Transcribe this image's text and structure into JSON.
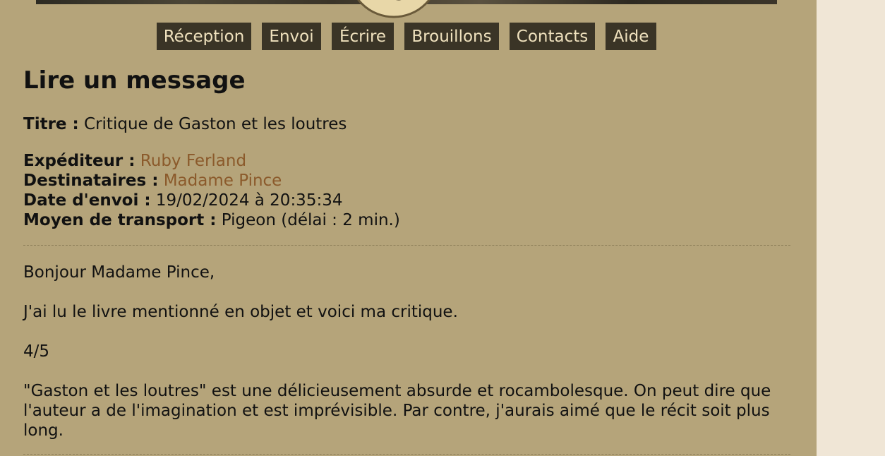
{
  "nav": {
    "items": [
      {
        "label": "Réception"
      },
      {
        "label": "Envoi"
      },
      {
        "label": "Écrire"
      },
      {
        "label": "Brouillons"
      },
      {
        "label": "Contacts"
      },
      {
        "label": "Aide"
      }
    ]
  },
  "page": {
    "title": "Lire un message"
  },
  "message": {
    "title_label": "Titre :",
    "title_value": "Critique de Gaston et les loutres",
    "sender_label": "Expéditeur :",
    "sender_value": "Ruby Ferland",
    "recipients_label": "Destinataires :",
    "recipients_value": "Madame Pince",
    "date_label": "Date d'envoi :",
    "date_value": "19/02/2024 à 20:35:34",
    "transport_label": "Moyen de transport :",
    "transport_value": "Pigeon (délai : 2 min.)",
    "body": {
      "greeting": "Bonjour Madame Pince,",
      "intro": "J'ai lu le livre mentionné en objet et voici ma critique.",
      "rating": "4/5",
      "review_line_1": "\"Gaston et les loutres\" est une délicieusement absurde et rocambolesque. On peut dire que",
      "review_line_2": "l'auteur a de l'imagination et est imprévisible. Par contre, j'aurais aimé que le récit soit plus",
      "review_line_3": "long."
    }
  },
  "colors": {
    "page_background": "#b5a47a",
    "side_background": "#f0e6d6",
    "nav_button_background": "#3a3426",
    "nav_button_text": "#efe1bd",
    "link": "#8b5a2b"
  }
}
